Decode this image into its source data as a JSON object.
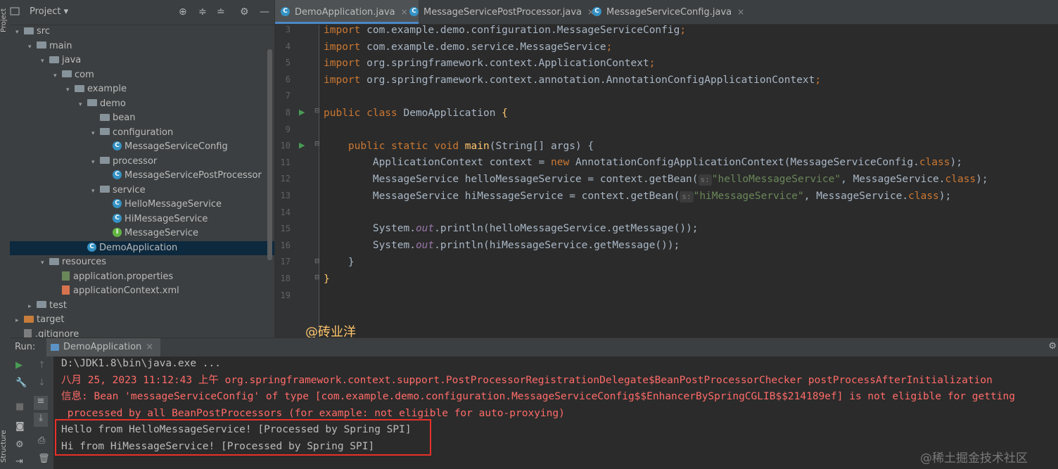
{
  "left_strip": {
    "project_label": "Project",
    "structure_label": "Structure"
  },
  "project_panel": {
    "title": "Project",
    "tree": [
      {
        "label": "src",
        "icon": "folder"
      },
      {
        "label": "main",
        "icon": "folder"
      },
      {
        "label": "java",
        "icon": "folder"
      },
      {
        "label": "com",
        "icon": "folder"
      },
      {
        "label": "example",
        "icon": "folder"
      },
      {
        "label": "demo",
        "icon": "folder"
      },
      {
        "label": "bean",
        "icon": "folder"
      },
      {
        "label": "configuration",
        "icon": "folder"
      },
      {
        "label": "MessageServiceConfig",
        "icon": "class"
      },
      {
        "label": "processor",
        "icon": "folder"
      },
      {
        "label": "MessageServicePostProcessor",
        "icon": "class"
      },
      {
        "label": "service",
        "icon": "folder"
      },
      {
        "label": "HelloMessageService",
        "icon": "class"
      },
      {
        "label": "HiMessageService",
        "icon": "class"
      },
      {
        "label": "MessageService",
        "icon": "interface"
      },
      {
        "label": "DemoApplication",
        "icon": "class",
        "selected": true
      },
      {
        "label": "resources",
        "icon": "folder"
      },
      {
        "label": "application.properties",
        "icon": "properties-file"
      },
      {
        "label": "applicationContext.xml",
        "icon": "xml-file"
      },
      {
        "label": "test",
        "icon": "folder"
      },
      {
        "label": "target",
        "icon": "folder-orange"
      },
      {
        "label": ".gitignore",
        "icon": "git-file"
      }
    ]
  },
  "tabs": [
    {
      "label": "DemoApplication.java",
      "active": true
    },
    {
      "label": "MessageServicePostProcessor.java",
      "active": false
    },
    {
      "label": "MessageServiceConfig.java",
      "active": false
    }
  ],
  "editor": {
    "line_numbers": [
      "3",
      "4",
      "5",
      "6",
      "7",
      "8",
      "9",
      "10",
      "11",
      "12",
      "13",
      "14",
      "15",
      "16",
      "17",
      "18",
      "19"
    ],
    "lines": {
      "l3": {
        "kw": "import",
        "rest": " com.example.demo.configuration.MessageServiceConfig",
        "semi": ";"
      },
      "l4": {
        "kw": "import",
        "rest": " com.example.demo.service.MessageService",
        "semi": ";"
      },
      "l5": {
        "kw": "import",
        "rest": " org.springframework.context.ApplicationContext",
        "semi": ";"
      },
      "l6": {
        "kw": "import",
        "rest": " org.springframework.context.annotation.AnnotationConfigApplicationContext",
        "semi": ";"
      },
      "l8": {
        "kw": "public class",
        "name": " DemoApplication ",
        "brace": "{"
      },
      "l10": {
        "kw": "public static void",
        "fn": "main",
        "rest": "(String[] args) {"
      },
      "l11": {
        "a": "ApplicationContext context = ",
        "kw": "new",
        "b": " AnnotationConfigApplicationContext(MessageServiceConfig.",
        "kw2": "class",
        "c": ");"
      },
      "l12": {
        "a": "MessageService helloMessageService = context.getBean(",
        "hint": "s:",
        "str": "\"helloMessageService\"",
        "b": ", MessageService.",
        "kw": "class",
        "c": ");"
      },
      "l13": {
        "a": "MessageService hiMessageService = context.getBean(",
        "hint": "s:",
        "str": "\"hiMessageService\"",
        "b": ", MessageService.",
        "kw": "class",
        "c": ");"
      },
      "l15": {
        "a": "System.",
        "fld": "out",
        "b": ".println(helloMessageService.getMessage());"
      },
      "l16": {
        "a": "System.",
        "fld": "out",
        "b": ".println(hiMessageService.getMessage());"
      },
      "l17": {
        "text": "}"
      },
      "l18": {
        "text": "}"
      }
    }
  },
  "watermark_author": "@砖业洋__",
  "run_panel": {
    "label": "Run:",
    "tab": "DemoApplication",
    "console": [
      {
        "text": "D:\\JDK1.8\\bin\\java.exe ...",
        "color": "gray"
      },
      {
        "text": "八月 25, 2023 11:12:43 上午 org.springframework.context.support.PostProcessorRegistrationDelegate$BeanPostProcessorChecker postProcessAfterInitialization",
        "color": "red"
      },
      {
        "text": "信息: Bean 'messageServiceConfig' of type [com.example.demo.configuration.MessageServiceConfig$$EnhancerBySpringCGLIB$$214189ef] is not eligible for getting",
        "color": "red"
      },
      {
        "text": " processed by all BeanPostProcessors (for example: not eligible for auto-proxying)",
        "color": "red"
      },
      {
        "text": "Hello from HelloMessageService! [Processed by Spring SPI]",
        "color": "gray"
      },
      {
        "text": "Hi from HiMessageService! [Processed by Spring SPI]",
        "color": "gray"
      }
    ]
  },
  "watermark_site": "@稀土掘金技术社区",
  "colors": {
    "accent": "#4a88c7",
    "highlight_box": "#e8302a",
    "error_text": "#ff6b68"
  }
}
